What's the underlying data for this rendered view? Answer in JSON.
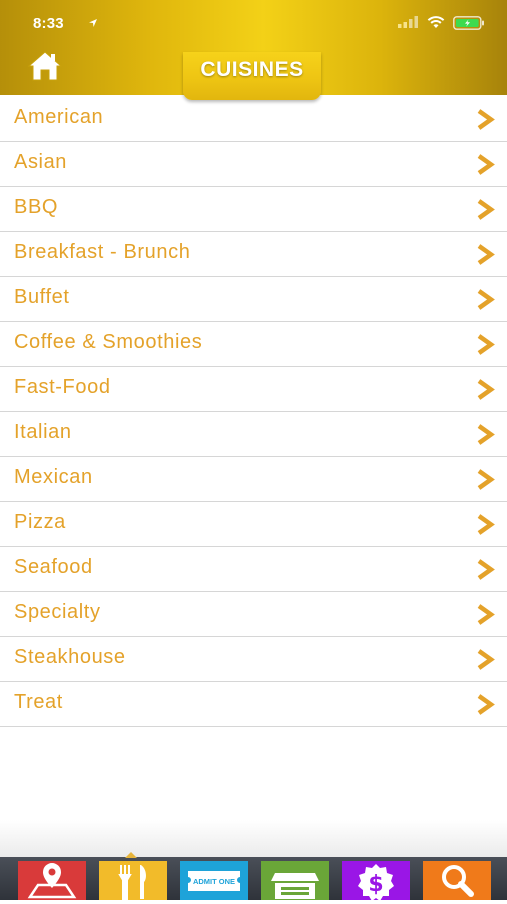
{
  "status_bar": {
    "time": "8:33"
  },
  "header": {
    "title": "CUISINES",
    "home_icon": "home-icon",
    "accent_color": "#e4a22a",
    "header_gold": "#e0b70d"
  },
  "cuisines": [
    {
      "label": "American"
    },
    {
      "label": "Asian"
    },
    {
      "label": "BBQ"
    },
    {
      "label": "Breakfast - Brunch"
    },
    {
      "label": "Buffet"
    },
    {
      "label": "Coffee & Smoothies"
    },
    {
      "label": "Fast-Food"
    },
    {
      "label": "Italian"
    },
    {
      "label": "Mexican"
    },
    {
      "label": "Pizza"
    },
    {
      "label": "Seafood"
    },
    {
      "label": "Specialty"
    },
    {
      "label": "Steakhouse"
    },
    {
      "label": "Treat"
    }
  ],
  "tabbar": {
    "tabs": [
      {
        "icon": "map-pin-icon",
        "color": "#d93a3a"
      },
      {
        "icon": "fork-knife-icon",
        "color": "#f2bb2a",
        "selected": true
      },
      {
        "icon": "ticket-icon",
        "color": "#1ea3d9",
        "ticket_text": "ADMIT ONE"
      },
      {
        "icon": "store-icon",
        "color": "#6aa638"
      },
      {
        "icon": "dollar-badge-icon",
        "color": "#9a16e6"
      },
      {
        "icon": "magnifier-icon",
        "color": "#f07a1a"
      }
    ]
  }
}
